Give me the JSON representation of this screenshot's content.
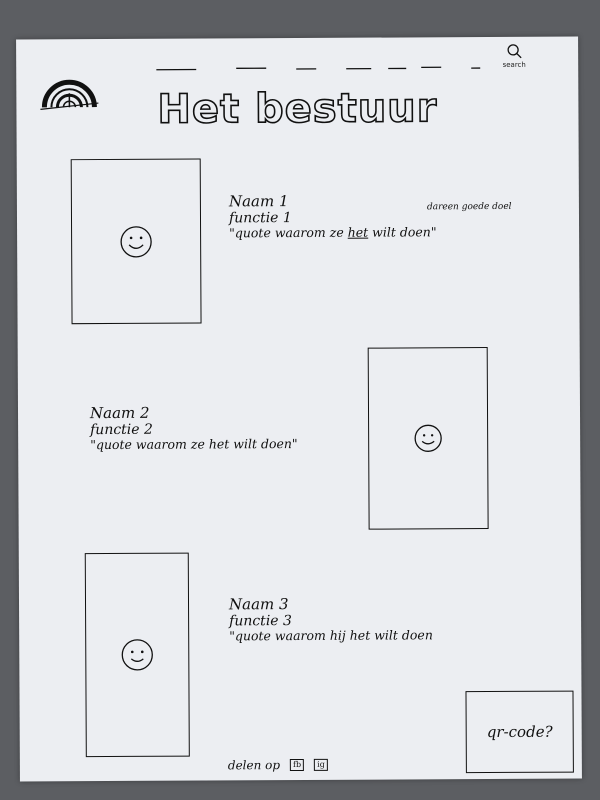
{
  "page": {
    "title": "Het bestuur",
    "search_label": "search"
  },
  "members": [
    {
      "name": "Naam 1",
      "function": "functie 1",
      "quote_start": "\"quote waarom ze ",
      "quote_struck": "het",
      "quote_end": " wilt doen\"",
      "note": "dareen goede doel"
    },
    {
      "name": "Naam 2",
      "function": "functie 2",
      "quote": "\"quote waarom ze het wilt doen\""
    },
    {
      "name": "Naam 3",
      "function": "functie 3",
      "quote": "\"quote waarom hij het wilt doen"
    }
  ],
  "footer": {
    "share_label": "delen op",
    "share_icon_1": "fb",
    "share_icon_2": "ig",
    "qr_label": "qr-code?"
  },
  "icons": [
    "rainbow-logo-icon",
    "search-icon",
    "smiley-face-icon"
  ],
  "colors": {
    "paper": "#eceef2",
    "ink": "#111111",
    "background": "#5c5e62"
  }
}
